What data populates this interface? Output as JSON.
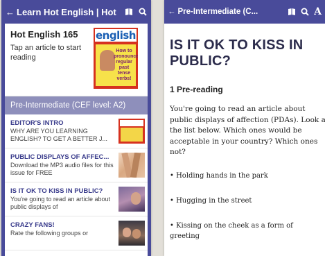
{
  "left": {
    "appbar": {
      "back_glyph": "←",
      "title": "Learn Hot English | Hot ...",
      "icons": [
        "book-icon",
        "search-icon"
      ]
    },
    "issue": {
      "title": "Hot English 165",
      "subtitle": "Tap an article to start reading",
      "cover_masthead": "english",
      "cover_blurb": "How to pronounce regular past tense verbs!"
    },
    "section_header": "Pre-Intermediate (CEF level: A2)",
    "articles": [
      {
        "title": "EDITOR'S INTRO",
        "desc": "WHY ARE YOU LEARNING ENGLISH? TO GET A BETTER J..."
      },
      {
        "title": "PUBLIC DISPLAYS OF AFFEC...",
        "desc": "Download the MP3 audio files for this issue for FREE"
      },
      {
        "title": "IS IT OK TO KISS IN PUBLIC?",
        "desc": "You're going to read an article about public displays of"
      },
      {
        "title": "CRAZY FANS!",
        "desc": "Rate the following groups or"
      }
    ]
  },
  "right": {
    "appbar": {
      "back_glyph": "←",
      "title": "Pre-Intermediate (C...",
      "icons": [
        "book-icon",
        "search-icon",
        "font-size-icon"
      ],
      "font_glyph": "A"
    },
    "heading": "IS IT OK TO KISS IN PUBLIC?",
    "subheading": "1 Pre-reading",
    "paragraph": "You're going to read an article about public displays of affection (PDAs). Look at the list below. Which ones would be acceptable in your country? Which ones not?",
    "bullets": [
      "• Holding hands in the park",
      "• Hugging in the street",
      "• Kissing on the cheek as a form of greeting"
    ]
  },
  "colors": {
    "accent": "#494b9a",
    "section": "#8e8fbb",
    "article_title": "#3a3c8c"
  }
}
